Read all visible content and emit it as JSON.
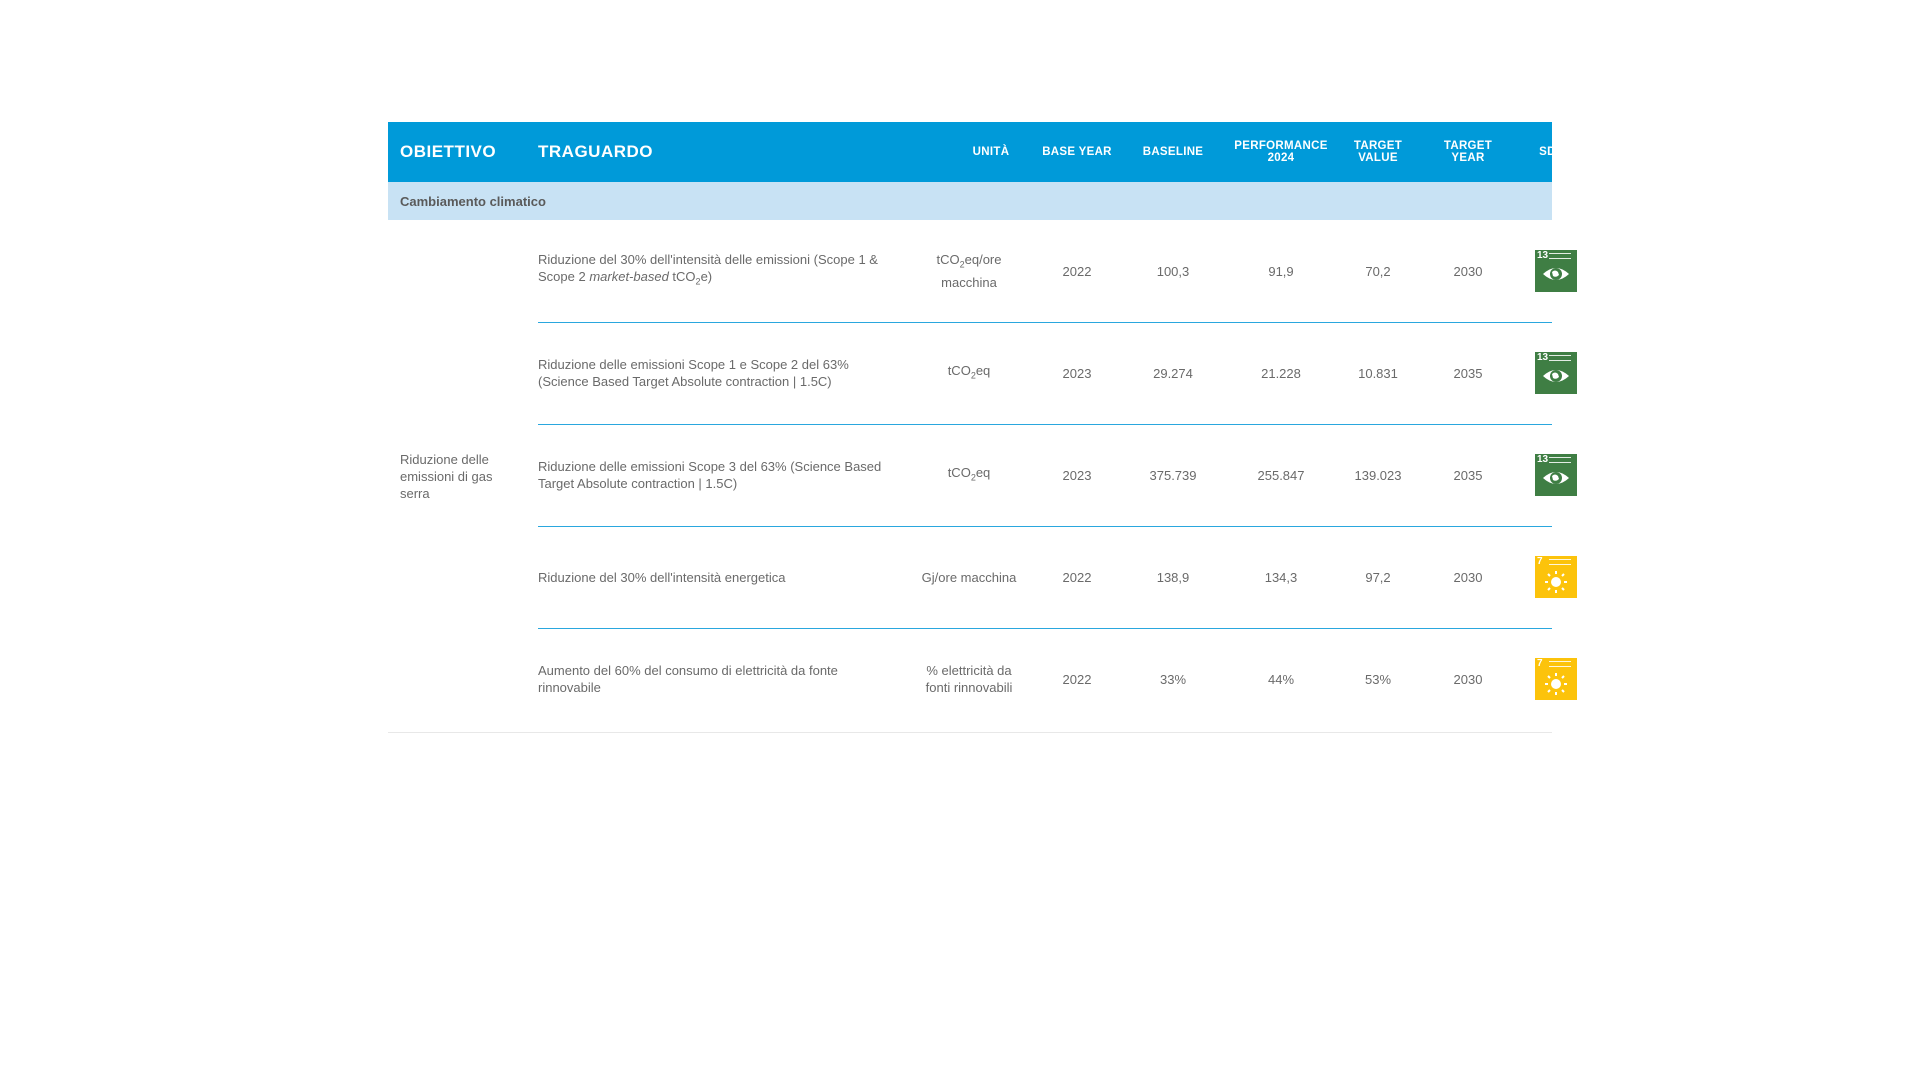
{
  "header": {
    "obiettivo": "OBIETTIVO",
    "traguardo": "TRAGUARDO",
    "unita": "UNITÀ",
    "base_year": "BASE YEAR",
    "baseline": "BASELINE",
    "performance_1": "PERFORMANCE",
    "performance_2": "2024",
    "target_value_1": "TARGET",
    "target_value_2": "VALUE",
    "target_year_1": "TARGET",
    "target_year_2": "YEAR",
    "sdgs": "SDGS"
  },
  "section": {
    "title": "Cambiamento climatico"
  },
  "objective": "Riduzione delle emissioni di gas serra",
  "rows": [
    {
      "traguardo_a": "Riduzione del 30% dell'intensità delle emissioni (Scope 1 & Scope 2 ",
      "traguardo_b": "market-based",
      "traguardo_c": " tCO",
      "traguardo_d": "2",
      "traguardo_e": "e)",
      "unit_a": "tCO",
      "unit_b": "2",
      "unit_c": "eq/ore macchina",
      "base_year": "2022",
      "baseline": "100,3",
      "performance": "91,9",
      "target_value": "70,2",
      "target_year": "2030",
      "sdg_number": "13",
      "sdg_icon": "climate-action-eye-globe",
      "sdg_color": "#3f7e44"
    },
    {
      "traguardo": "Riduzione delle emissioni Scope 1 e Scope 2 del 63% (Science Based Target Absolute contraction | 1.5C)",
      "unit_a": "tCO",
      "unit_b": "2",
      "unit_c": "eq",
      "base_year": "2023",
      "baseline": "29.274",
      "performance": "21.228",
      "target_value": "10.831",
      "target_year": "2035",
      "sdg_number": "13",
      "sdg_icon": "climate-action-eye-globe",
      "sdg_color": "#3f7e44"
    },
    {
      "traguardo": "Riduzione delle emissioni Scope 3 del 63% (Science Based Target Absolute contraction | 1.5C)",
      "unit_a": "tCO",
      "unit_b": "2",
      "unit_c": "eq",
      "base_year": "2023",
      "baseline": "375.739",
      "performance": "255.847",
      "target_value": "139.023",
      "target_year": "2035",
      "sdg_number": "13",
      "sdg_icon": "climate-action-eye-globe",
      "sdg_color": "#3f7e44"
    },
    {
      "traguardo": "Riduzione del 30% dell'intensità energetica",
      "unit": "Gj/ore macchina",
      "base_year": "2022",
      "baseline": "138,9",
      "performance": "134,3",
      "target_value": "97,2",
      "target_year": "2030",
      "sdg_number": "7",
      "sdg_icon": "affordable-clean-energy-sun",
      "sdg_color": "#fcc30b"
    },
    {
      "traguardo": "Aumento del 60% del consumo di elettricità da fonte rinnovabile",
      "unit": "% elettricità da fonti rinnovabili",
      "base_year": "2022",
      "baseline": "33%",
      "performance": "44%",
      "target_value": "53%",
      "target_year": "2030",
      "sdg_number": "7",
      "sdg_icon": "affordable-clean-energy-sun",
      "sdg_color": "#fcc30b"
    }
  ]
}
